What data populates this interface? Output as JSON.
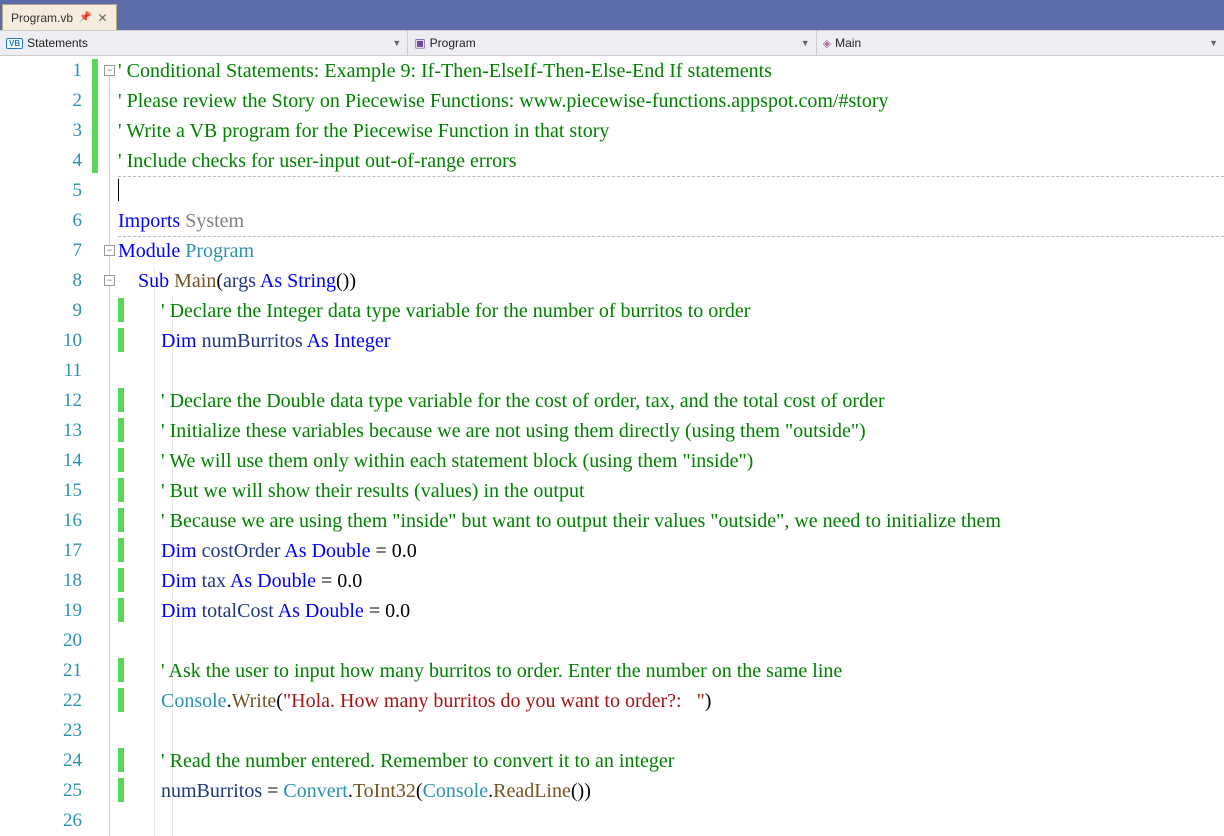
{
  "tab": {
    "filename": "Program.vb"
  },
  "nav": {
    "scope": "Statements",
    "module": "Program",
    "method": "Main"
  },
  "code": {
    "l1": "' Conditional Statements: Example 9: If-Then-ElseIf-Then-Else-End If statements",
    "l2": "' Please review the Story on Piecewise Functions: www.piecewise-functions.appspot.com/#story",
    "l3": "' Write a VB program for the Piecewise Function in that story",
    "l4": "' Include checks for user-input out-of-range errors",
    "l6_imports": "Imports",
    "l6_system": " System",
    "l7_module": "Module",
    "l7_program": " Program",
    "l8_sub": "Sub",
    "l8_main": " Main",
    "l8_args": "args ",
    "l8_as": "As",
    "l8_string": " String",
    "l9": "' Declare the Integer data type variable for the number of burritos to order",
    "l10_dim": "Dim",
    "l10_name": " numBurritos ",
    "l10_as": "As",
    "l10_type": " Integer",
    "l12": "' Declare the Double data type variable for the cost of order, tax, and the total cost of order",
    "l13": "' Initialize these variables because we are not using them directly (using them \"outside\")",
    "l14": "' We will use them only within each statement block (using them \"inside\")",
    "l15": "' But we will show their results (values) in the output",
    "l16": "' Because we are using them \"inside\" but want to output their values \"outside\", we need to initialize them",
    "l17_dim": "Dim",
    "l17_name": " costOrder ",
    "l17_as": "As",
    "l17_type": " Double",
    "l17_tail": " = 0.0",
    "l18_dim": "Dim",
    "l18_name": " tax ",
    "l18_as": "As",
    "l18_type": " Double",
    "l18_tail": " = 0.0",
    "l19_dim": "Dim",
    "l19_name": " totalCost ",
    "l19_as": "As",
    "l19_type": " Double",
    "l19_tail": " = 0.0",
    "l21": "' Ask the user to input how many burritos to order. Enter the number on the same line",
    "l22_console": "Console",
    "l22_write": "Write",
    "l22_str": "\"Hola. How many burritos do you want to order?:   \"",
    "l24": "' Read the number entered. Remember to convert it to an integer",
    "l25_num": "numBurritos",
    "l25_eq": " = ",
    "l25_convert": "Convert",
    "l25_toint": "ToInt32",
    "l25_console": "Console",
    "l25_readline": "ReadLine"
  },
  "line_numbers": [
    "1",
    "2",
    "3",
    "4",
    "5",
    "6",
    "7",
    "8",
    "9",
    "10",
    "11",
    "12",
    "13",
    "14",
    "15",
    "16",
    "17",
    "18",
    "19",
    "20",
    "21",
    "22",
    "23",
    "24",
    "25",
    "26"
  ]
}
